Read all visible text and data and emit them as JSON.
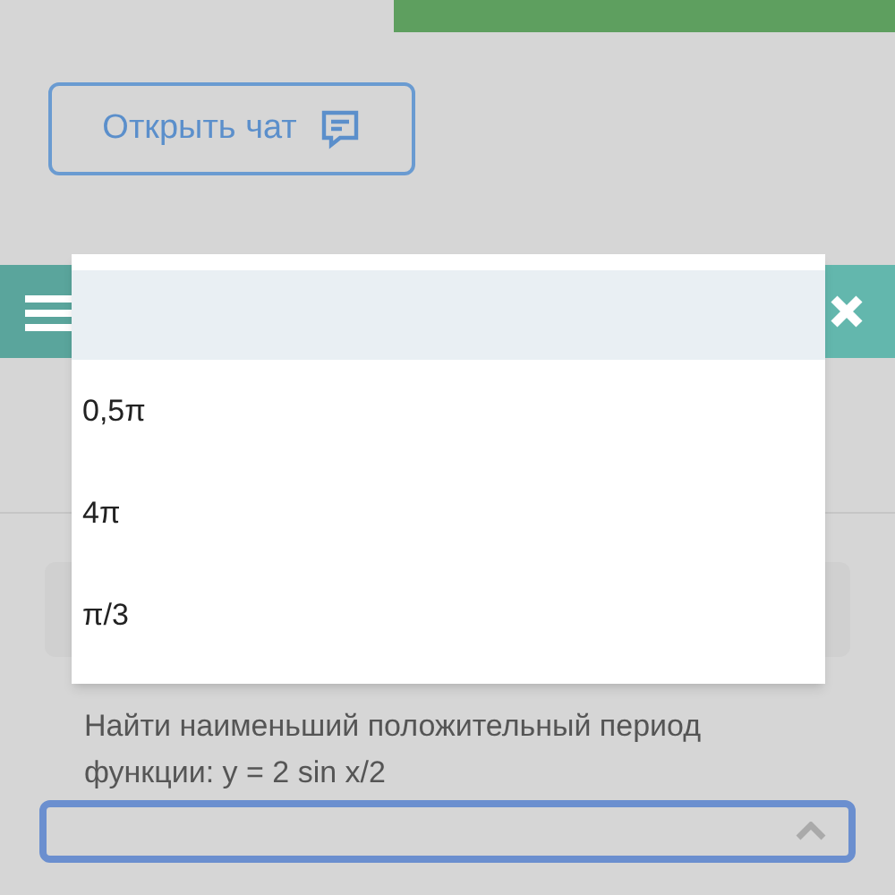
{
  "chat_button": {
    "label": "Открыть чат"
  },
  "dropdown": {
    "options": [
      {
        "label": "0,5π",
        "selected": false
      },
      {
        "label": "4π",
        "selected": false
      },
      {
        "label": "π/3",
        "selected": false
      }
    ]
  },
  "question": {
    "text": "Найти наименьший положительный период функции: y = 2 sin x/2"
  },
  "answer_select": {
    "expanded": true
  }
}
